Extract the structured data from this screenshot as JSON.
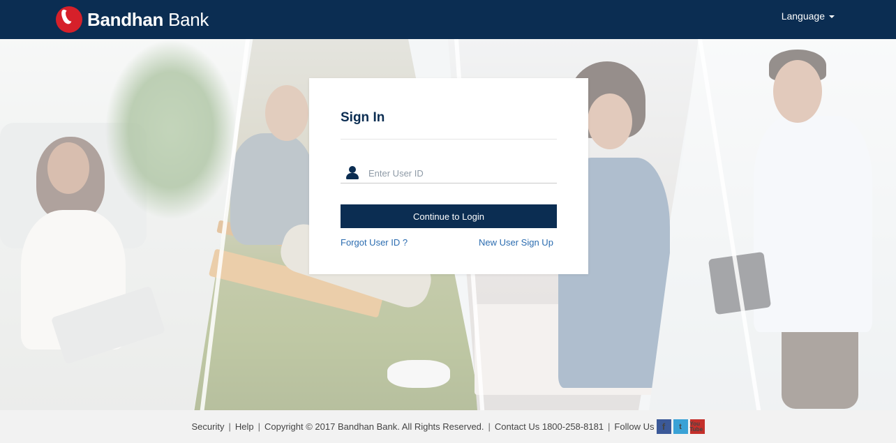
{
  "header": {
    "brand_bold": "Bandhan",
    "brand_light": "Bank",
    "language_label": "Language"
  },
  "login": {
    "title": "Sign In",
    "user_id_placeholder": "Enter User ID",
    "continue_label": "Continue to Login",
    "forgot_label": "Forgot User ID ?",
    "signup_label": "New User Sign Up"
  },
  "footer": {
    "security": "Security",
    "help": "Help",
    "copyright": "Copyright © 2017 Bandhan Bank. All Rights Reserved.",
    "contact": "Contact Us 1800-258-8181",
    "follow": "Follow Us",
    "separator": "|",
    "social": [
      {
        "name": "facebook-icon",
        "glyph": "f"
      },
      {
        "name": "twitter-icon",
        "glyph": "t"
      },
      {
        "name": "youtube-icon",
        "glyph": "You Tube"
      }
    ]
  },
  "colors": {
    "navy": "#0b2d52",
    "brand_red": "#d6202a",
    "link_blue": "#2b6cb0",
    "footer_bg": "#f2f2f2"
  }
}
